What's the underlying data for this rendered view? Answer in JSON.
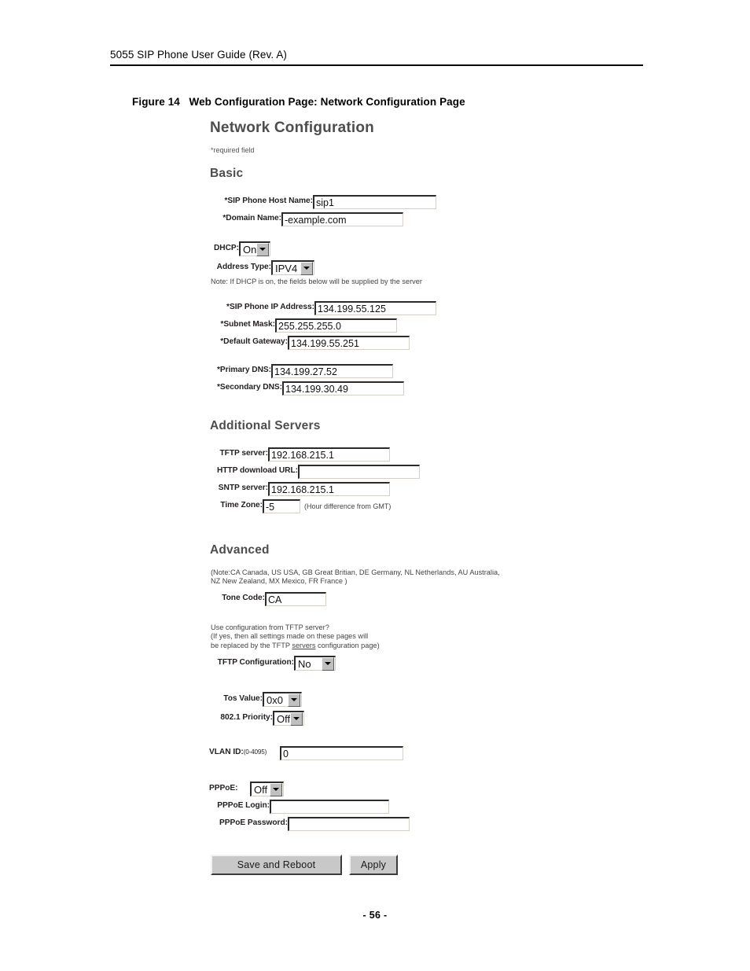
{
  "document": {
    "running_header": "5055 SIP Phone User Guide (Rev. A)",
    "figure_caption": "Figure 14   Web Configuration Page: Network Configuration Page",
    "page_number": "- 56 -"
  },
  "webpage": {
    "title": "Network Configuration",
    "required_note": "*required field",
    "sections": {
      "basic": {
        "heading": "Basic",
        "fields": {
          "sip_host_name": {
            "label": "*SIP Phone Host Name:",
            "value": "sip1"
          },
          "domain_name": {
            "label": "*Domain Name:",
            "value": "-example.com"
          },
          "dhcp": {
            "label": "DHCP:",
            "value": "On"
          },
          "address_type": {
            "label": "Address Type:",
            "value": "IPV4"
          },
          "dhcp_note": "Note: If DHCP is on, the fields below will be supplied by the server",
          "sip_ip_address": {
            "label": "*SIP Phone IP Address:",
            "value": "134.199.55.125"
          },
          "subnet_mask": {
            "label": "*Subnet Mask:",
            "value": "255.255.255.0"
          },
          "default_gateway": {
            "label": "*Default Gateway:",
            "value": "134.199.55.251"
          },
          "primary_dns": {
            "label": "*Primary DNS:",
            "value": "134.199.27.52"
          },
          "secondary_dns": {
            "label": "*Secondary DNS:",
            "value": "134.199.30.49"
          }
        }
      },
      "additional_servers": {
        "heading": "Additional Servers",
        "fields": {
          "tftp_server": {
            "label": "TFTP server:",
            "value": "192.168.215.1"
          },
          "http_download_url": {
            "label": "HTTP download URL:",
            "value": ""
          },
          "sntp_server": {
            "label": "SNTP server:",
            "value": "192.168.215.1"
          },
          "time_zone": {
            "label": "Time Zone:",
            "value": "-5",
            "suffix": "(Hour difference from GMT)"
          }
        }
      },
      "advanced": {
        "heading": "Advanced",
        "tone_note_line1": "(Note:CA Canada, US USA, GB Great Britian, DE Germany, NL Netherlands, AU Australia,",
        "tone_note_line2": "NZ New Zealand, MX Mexico, FR France )",
        "tftp_note_line1": "Use configuration from TFTP server?",
        "tftp_note_line2": "(If yes, then all settings made on these pages will",
        "tftp_note_line3a": "be replaced by the TFTP ",
        "tftp_note_line3b": "servers",
        "tftp_note_line3c": " configuration page)",
        "fields": {
          "tone_code": {
            "label": "Tone Code:",
            "value": "CA"
          },
          "tftp_configuration": {
            "label": "TFTP Configuration:",
            "value": "No"
          },
          "tos_value": {
            "label": "Tos Value:",
            "value": "0x0"
          },
          "priority_8021": {
            "label": "802.1 Priority:",
            "value": "Off"
          },
          "vlan_id": {
            "label": "VLAN ID:",
            "label_range": "(0-4095)",
            "value": "0"
          },
          "pppoe": {
            "label": "PPPoE:",
            "value": "Off"
          },
          "pppoe_login": {
            "label": "PPPoE Login:",
            "value": ""
          },
          "pppoe_password": {
            "label": "PPPoE Password:",
            "value": ""
          }
        }
      }
    },
    "buttons": {
      "save_and_reboot": "Save and Reboot",
      "apply": "Apply"
    }
  }
}
